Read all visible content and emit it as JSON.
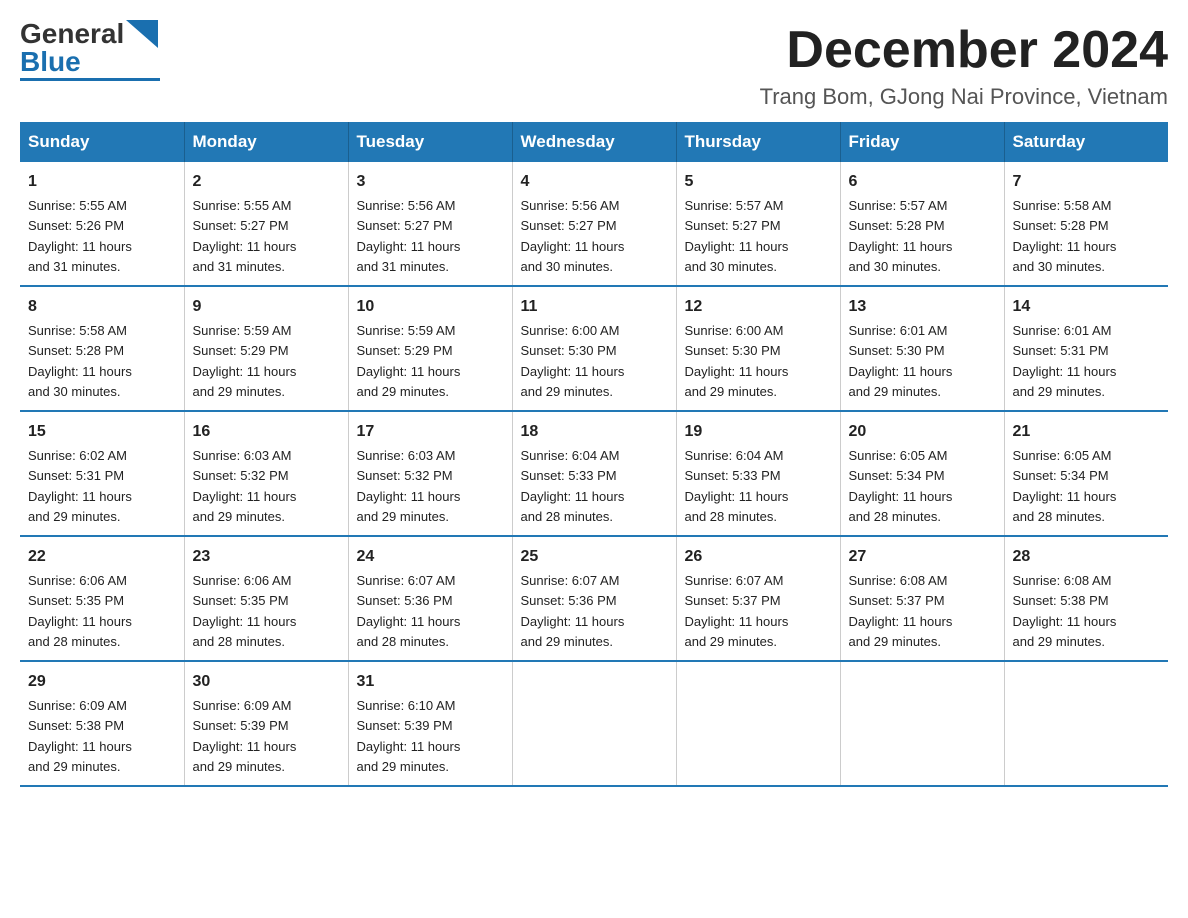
{
  "logo": {
    "general": "General",
    "blue": "Blue"
  },
  "title": "December 2024",
  "subtitle": "Trang Bom, GJong Nai Province, Vietnam",
  "weekdays": [
    "Sunday",
    "Monday",
    "Tuesday",
    "Wednesday",
    "Thursday",
    "Friday",
    "Saturday"
  ],
  "weeks": [
    [
      {
        "day": "1",
        "sunrise": "5:55 AM",
        "sunset": "5:26 PM",
        "daylight": "11 hours and 31 minutes."
      },
      {
        "day": "2",
        "sunrise": "5:55 AM",
        "sunset": "5:27 PM",
        "daylight": "11 hours and 31 minutes."
      },
      {
        "day": "3",
        "sunrise": "5:56 AM",
        "sunset": "5:27 PM",
        "daylight": "11 hours and 31 minutes."
      },
      {
        "day": "4",
        "sunrise": "5:56 AM",
        "sunset": "5:27 PM",
        "daylight": "11 hours and 30 minutes."
      },
      {
        "day": "5",
        "sunrise": "5:57 AM",
        "sunset": "5:27 PM",
        "daylight": "11 hours and 30 minutes."
      },
      {
        "day": "6",
        "sunrise": "5:57 AM",
        "sunset": "5:28 PM",
        "daylight": "11 hours and 30 minutes."
      },
      {
        "day": "7",
        "sunrise": "5:58 AM",
        "sunset": "5:28 PM",
        "daylight": "11 hours and 30 minutes."
      }
    ],
    [
      {
        "day": "8",
        "sunrise": "5:58 AM",
        "sunset": "5:28 PM",
        "daylight": "11 hours and 30 minutes."
      },
      {
        "day": "9",
        "sunrise": "5:59 AM",
        "sunset": "5:29 PM",
        "daylight": "11 hours and 29 minutes."
      },
      {
        "day": "10",
        "sunrise": "5:59 AM",
        "sunset": "5:29 PM",
        "daylight": "11 hours and 29 minutes."
      },
      {
        "day": "11",
        "sunrise": "6:00 AM",
        "sunset": "5:30 PM",
        "daylight": "11 hours and 29 minutes."
      },
      {
        "day": "12",
        "sunrise": "6:00 AM",
        "sunset": "5:30 PM",
        "daylight": "11 hours and 29 minutes."
      },
      {
        "day": "13",
        "sunrise": "6:01 AM",
        "sunset": "5:30 PM",
        "daylight": "11 hours and 29 minutes."
      },
      {
        "day": "14",
        "sunrise": "6:01 AM",
        "sunset": "5:31 PM",
        "daylight": "11 hours and 29 minutes."
      }
    ],
    [
      {
        "day": "15",
        "sunrise": "6:02 AM",
        "sunset": "5:31 PM",
        "daylight": "11 hours and 29 minutes."
      },
      {
        "day": "16",
        "sunrise": "6:03 AM",
        "sunset": "5:32 PM",
        "daylight": "11 hours and 29 minutes."
      },
      {
        "day": "17",
        "sunrise": "6:03 AM",
        "sunset": "5:32 PM",
        "daylight": "11 hours and 29 minutes."
      },
      {
        "day": "18",
        "sunrise": "6:04 AM",
        "sunset": "5:33 PM",
        "daylight": "11 hours and 28 minutes."
      },
      {
        "day": "19",
        "sunrise": "6:04 AM",
        "sunset": "5:33 PM",
        "daylight": "11 hours and 28 minutes."
      },
      {
        "day": "20",
        "sunrise": "6:05 AM",
        "sunset": "5:34 PM",
        "daylight": "11 hours and 28 minutes."
      },
      {
        "day": "21",
        "sunrise": "6:05 AM",
        "sunset": "5:34 PM",
        "daylight": "11 hours and 28 minutes."
      }
    ],
    [
      {
        "day": "22",
        "sunrise": "6:06 AM",
        "sunset": "5:35 PM",
        "daylight": "11 hours and 28 minutes."
      },
      {
        "day": "23",
        "sunrise": "6:06 AM",
        "sunset": "5:35 PM",
        "daylight": "11 hours and 28 minutes."
      },
      {
        "day": "24",
        "sunrise": "6:07 AM",
        "sunset": "5:36 PM",
        "daylight": "11 hours and 28 minutes."
      },
      {
        "day": "25",
        "sunrise": "6:07 AM",
        "sunset": "5:36 PM",
        "daylight": "11 hours and 29 minutes."
      },
      {
        "day": "26",
        "sunrise": "6:07 AM",
        "sunset": "5:37 PM",
        "daylight": "11 hours and 29 minutes."
      },
      {
        "day": "27",
        "sunrise": "6:08 AM",
        "sunset": "5:37 PM",
        "daylight": "11 hours and 29 minutes."
      },
      {
        "day": "28",
        "sunrise": "6:08 AM",
        "sunset": "5:38 PM",
        "daylight": "11 hours and 29 minutes."
      }
    ],
    [
      {
        "day": "29",
        "sunrise": "6:09 AM",
        "sunset": "5:38 PM",
        "daylight": "11 hours and 29 minutes."
      },
      {
        "day": "30",
        "sunrise": "6:09 AM",
        "sunset": "5:39 PM",
        "daylight": "11 hours and 29 minutes."
      },
      {
        "day": "31",
        "sunrise": "6:10 AM",
        "sunset": "5:39 PM",
        "daylight": "11 hours and 29 minutes."
      },
      null,
      null,
      null,
      null
    ]
  ],
  "labels": {
    "sunrise": "Sunrise:",
    "sunset": "Sunset:",
    "daylight": "Daylight:"
  }
}
